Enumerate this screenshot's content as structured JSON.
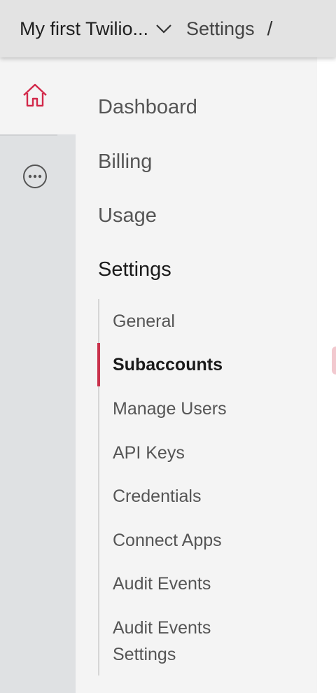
{
  "header": {
    "account_name": "My first Twilio...",
    "breadcrumb": "Settings",
    "breadcrumb_separator": "/"
  },
  "rail": {
    "icons": [
      "home-icon",
      "more-icon"
    ],
    "accent_color": "#d2294a"
  },
  "nav": {
    "items": [
      {
        "label": "Dashboard"
      },
      {
        "label": "Billing"
      },
      {
        "label": "Usage"
      },
      {
        "label": "Settings"
      }
    ],
    "settings_subitems": [
      {
        "label": "General"
      },
      {
        "label": "Subaccounts",
        "active": true
      },
      {
        "label": "Manage Users"
      },
      {
        "label": "API Keys"
      },
      {
        "label": "Credentials"
      },
      {
        "label": "Connect Apps"
      },
      {
        "label": "Audit Events"
      },
      {
        "label": "Audit Events\nSettings"
      }
    ]
  }
}
